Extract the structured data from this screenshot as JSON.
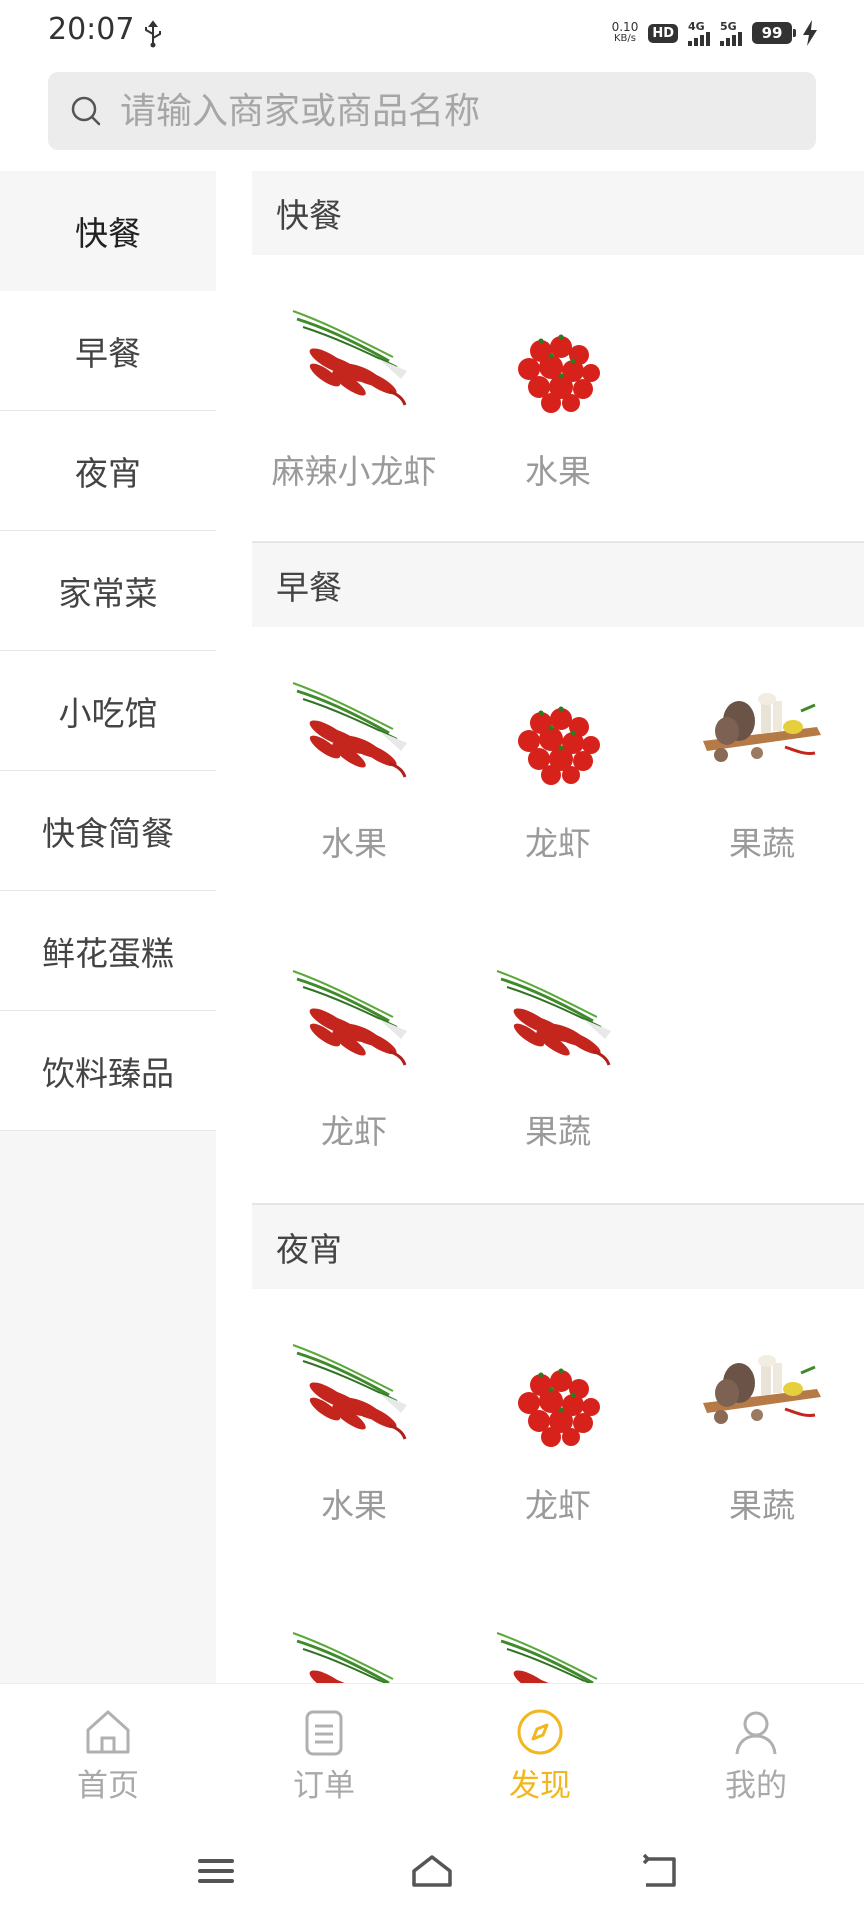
{
  "status_bar": {
    "time": "20:07",
    "net_speed_value": "0.10",
    "net_speed_unit": "KB/s",
    "hd": "HD",
    "signal_1": "4G",
    "signal_2": "5G",
    "battery": "99"
  },
  "search": {
    "placeholder": "请输入商家或商品名称"
  },
  "sidebar": {
    "items": [
      {
        "label": "快餐"
      },
      {
        "label": "早餐"
      },
      {
        "label": "夜宵"
      },
      {
        "label": "家常菜"
      },
      {
        "label": "小吃馆"
      },
      {
        "label": "快食简餐"
      },
      {
        "label": "鲜花蛋糕"
      },
      {
        "label": "饮料臻品"
      }
    ]
  },
  "sections": [
    {
      "title": "快餐",
      "items": [
        {
          "label": "麻辣小龙虾",
          "icon": "crayfish-image"
        },
        {
          "label": "水果",
          "icon": "tomato-image"
        }
      ]
    },
    {
      "title": "早餐",
      "items": [
        {
          "label": "水果",
          "icon": "crayfish-image"
        },
        {
          "label": "龙虾",
          "icon": "tomato-image"
        },
        {
          "label": "果蔬",
          "icon": "mushroom-image"
        },
        {
          "label": "龙虾",
          "icon": "crayfish-image"
        },
        {
          "label": "果蔬",
          "icon": "crayfish-image"
        }
      ]
    },
    {
      "title": "夜宵",
      "items": [
        {
          "label": "水果",
          "icon": "crayfish-image"
        },
        {
          "label": "龙虾",
          "icon": "tomato-image"
        },
        {
          "label": "果蔬",
          "icon": "mushroom-image"
        }
      ]
    }
  ],
  "tabbar": {
    "items": [
      {
        "label": "首页",
        "icon": "home-icon"
      },
      {
        "label": "订单",
        "icon": "order-icon"
      },
      {
        "label": "发现",
        "icon": "compass-icon",
        "active": true
      },
      {
        "label": "我的",
        "icon": "user-icon"
      }
    ],
    "active_color": "#f2b61f",
    "inactive_color": "#a9a9a9"
  }
}
